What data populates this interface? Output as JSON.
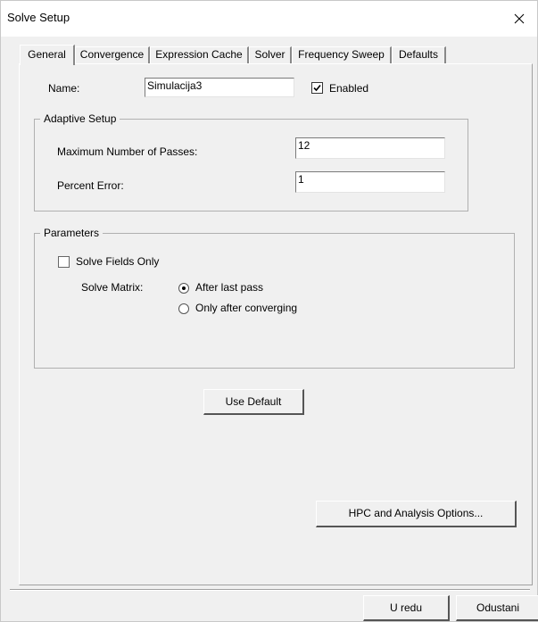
{
  "window": {
    "title": "Solve Setup",
    "close_glyph": "✕"
  },
  "tabs": [
    {
      "label": "General"
    },
    {
      "label": "Convergence"
    },
    {
      "label": "Expression Cache"
    },
    {
      "label": "Solver"
    },
    {
      "label": "Frequency Sweep"
    },
    {
      "label": "Defaults"
    }
  ],
  "active_tab": "General",
  "general": {
    "name_label": "Name:",
    "name_value": "Simulacija3",
    "enabled_label": "Enabled",
    "enabled_checked": true
  },
  "adaptive_setup": {
    "title": "Adaptive Setup",
    "max_passes_label": "Maximum Number of Passes:",
    "max_passes_value": "12",
    "percent_error_label": "Percent Error:",
    "percent_error_value": "1"
  },
  "parameters": {
    "title": "Parameters",
    "solve_fields_only_label": "Solve Fields Only",
    "solve_fields_only_checked": false,
    "solve_matrix_label": "Solve Matrix:",
    "solve_matrix_options": [
      {
        "label": "After last pass",
        "selected": true
      },
      {
        "label": "Only after converging",
        "selected": false
      }
    ]
  },
  "buttons": {
    "use_default": "Use Default",
    "hpc_options": "HPC and Analysis Options...",
    "ok": "U redu",
    "cancel": "Odustani"
  },
  "icons": {
    "close": "close-icon",
    "check": "checkmark-icon",
    "radio": "radio-dot-icon"
  }
}
